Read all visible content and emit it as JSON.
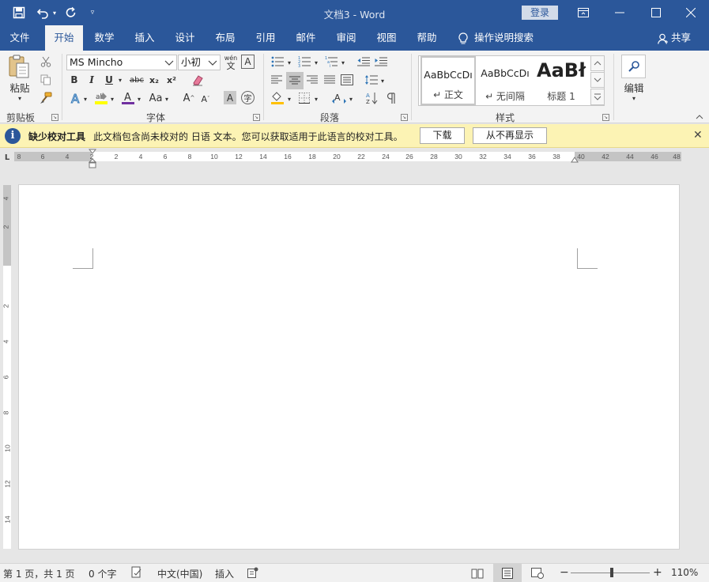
{
  "titlebar": {
    "doc_title": "文档3  -  Word",
    "login_label": "登录"
  },
  "tabs": [
    {
      "label": "文件"
    },
    {
      "label": "开始"
    },
    {
      "label": "数学"
    },
    {
      "label": "插入"
    },
    {
      "label": "设计"
    },
    {
      "label": "布局"
    },
    {
      "label": "引用"
    },
    {
      "label": "邮件"
    },
    {
      "label": "审阅"
    },
    {
      "label": "视图"
    },
    {
      "label": "帮助"
    }
  ],
  "active_tab": "开始",
  "tell_me": "操作说明搜索",
  "share_label": "共享",
  "ribbon": {
    "clipboard": {
      "paste_label": "粘贴",
      "group_label": "剪贴板"
    },
    "font": {
      "font_name": "MS Mincho",
      "font_size": "小初",
      "group_label": "字体",
      "phonetic_top": "wén",
      "phonetic_bottom": "文",
      "bold": "B",
      "italic": "I",
      "underline": "U",
      "strike": "abc",
      "subscript": "x₂",
      "superscript": "x²",
      "font_color_letter": "A",
      "change_case": "Aa",
      "grow": "A",
      "shrink": "A",
      "char_shading": "A",
      "enclose": "字"
    },
    "paragraph": {
      "group_label": "段落"
    },
    "styles": {
      "group_label": "样式",
      "items": [
        {
          "sample": "AaBbCcDı",
          "name": "↵ 正文"
        },
        {
          "sample": "AaBbCcDı",
          "name": "↵ 无间隔"
        },
        {
          "sample": "AaBł",
          "name": "标题 1"
        }
      ]
    },
    "editing": {
      "label": "编辑"
    }
  },
  "message_bar": {
    "title": "缺少校对工具",
    "text": "此文档包含尚未校对的 日语 文本。您可以获取适用于此语言的校对工具。",
    "download_label": "下载",
    "dismiss_label": "从不再显示"
  },
  "ruler": {
    "ruler_type": "L",
    "left_ticks": [
      "8",
      "6",
      "4",
      "2"
    ],
    "right_ticks": [
      "2",
      "4",
      "6",
      "8",
      "10",
      "12",
      "14",
      "16",
      "18",
      "20",
      "22",
      "24",
      "26",
      "28",
      "30",
      "32",
      "34",
      "36",
      "38",
      "40",
      "42",
      "44",
      "46",
      "48"
    ],
    "vertical_ticks": [
      "4",
      "2",
      "",
      "2",
      "4",
      "6",
      "8",
      "10",
      "12",
      "14"
    ]
  },
  "status": {
    "page": "第 1 页，共 1 页",
    "words": "0 个字",
    "language": "中文(中国)",
    "mode": "插入",
    "zoom": "110%"
  },
  "colors": {
    "brand": "#2b579a",
    "message_bar": "#fcf3b4",
    "highlight_yellow": "#ffff00",
    "font_color_red": "#7030a0"
  }
}
